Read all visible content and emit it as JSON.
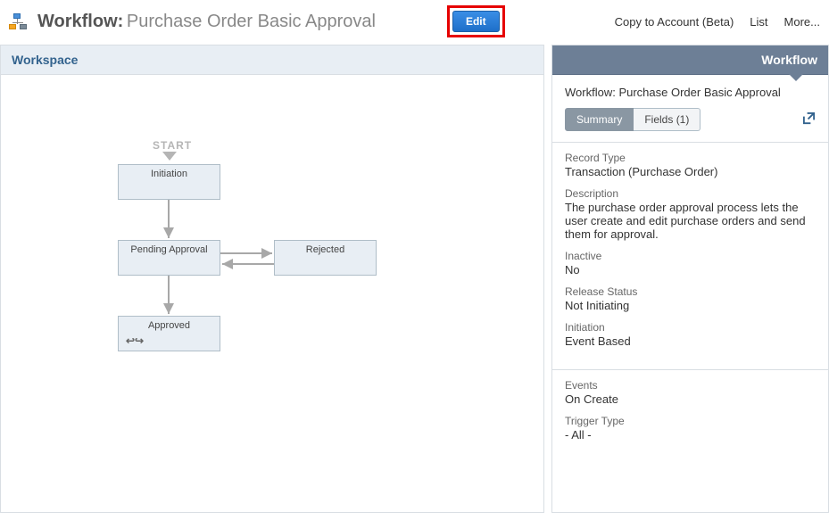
{
  "header": {
    "title_label": "Workflow:",
    "title_name": "Purchase Order Basic Approval",
    "edit_label": "Edit",
    "links": {
      "copy": "Copy to Account (Beta)",
      "list": "List",
      "more": "More..."
    }
  },
  "workspace": {
    "title": "Workspace",
    "start_label": "START",
    "nodes": {
      "initiation": "Initiation",
      "pending": "Pending Approval",
      "rejected": "Rejected",
      "approved": "Approved"
    }
  },
  "panel": {
    "header": "Workflow",
    "name_prefix": "Workflow:",
    "name": "Purchase Order Basic Approval",
    "tabs": {
      "summary": "Summary",
      "fields": "Fields (1)"
    },
    "fields": {
      "record_type_label": "Record Type",
      "record_type_value": "Transaction (Purchase Order)",
      "description_label": "Description",
      "description_value": "The purchase order approval process lets the user create and edit purchase orders and send them for approval.",
      "inactive_label": "Inactive",
      "inactive_value": "No",
      "release_status_label": "Release Status",
      "release_status_value": "Not Initiating",
      "initiation_label": "Initiation",
      "initiation_value": "Event Based",
      "events_label": "Events",
      "events_value": "On Create",
      "trigger_type_label": "Trigger Type",
      "trigger_type_value": "- All -"
    }
  }
}
